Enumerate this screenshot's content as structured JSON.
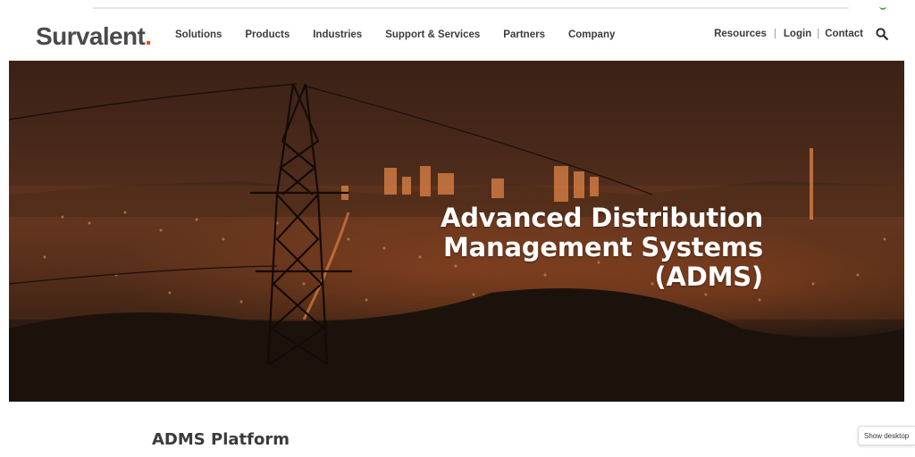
{
  "header": {
    "logo_text": "Survalent",
    "logo_dot": ".",
    "nav": [
      "Solutions",
      "Products",
      "Industries",
      "Support & Services",
      "Partners",
      "Company"
    ],
    "utility": {
      "resources": "Resources",
      "separator": "|",
      "login": "Login",
      "contact": "Contact"
    }
  },
  "hero": {
    "title_lines": [
      "Advanced Distribution",
      "Management Systems",
      "(ADMS)"
    ]
  },
  "section": {
    "title": "ADMS Platform"
  },
  "floating": {
    "desktop_button": "Show desktop"
  },
  "colors": {
    "brand_accent": "#e0501e",
    "hero_tint": "#5b321e",
    "text_dark": "#3b3b3b"
  }
}
